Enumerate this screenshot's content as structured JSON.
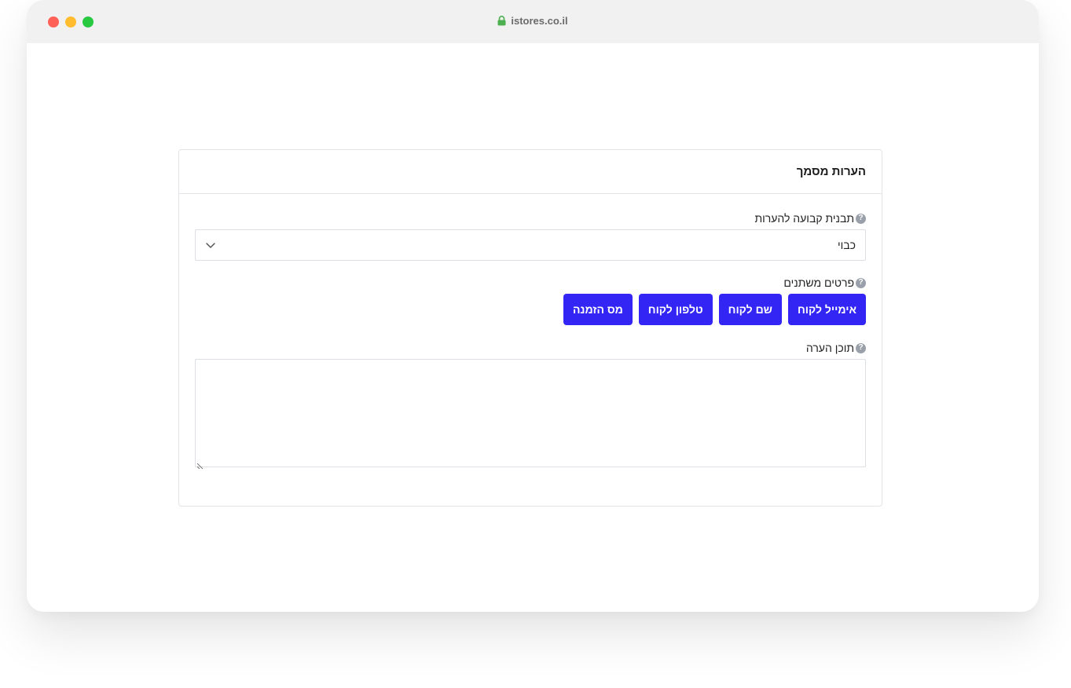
{
  "browser": {
    "url": "istores.co.il"
  },
  "card": {
    "title": "הערות מסמך",
    "template_field": {
      "label": "תבנית קבועה להערות",
      "selected": "כבוי",
      "help": "?"
    },
    "variables_field": {
      "label": "פרטים משתנים",
      "help": "?",
      "buttons": [
        {
          "label": "אימייל לקוח"
        },
        {
          "label": "שם לקוח"
        },
        {
          "label": "טלפון לקוח"
        },
        {
          "label": "מס הזמנה"
        }
      ]
    },
    "content_field": {
      "label": "תוכן הערה",
      "help": "?",
      "value": ""
    }
  },
  "colors": {
    "button_bg": "#3326f5",
    "help_icon": "#9aa0aa",
    "lock": "#4cb050"
  },
  "icons": {
    "lock": "lock-icon",
    "help": "question-circle-icon",
    "chevron": "chevron-down-icon",
    "resize": "resize-handle-icon"
  }
}
